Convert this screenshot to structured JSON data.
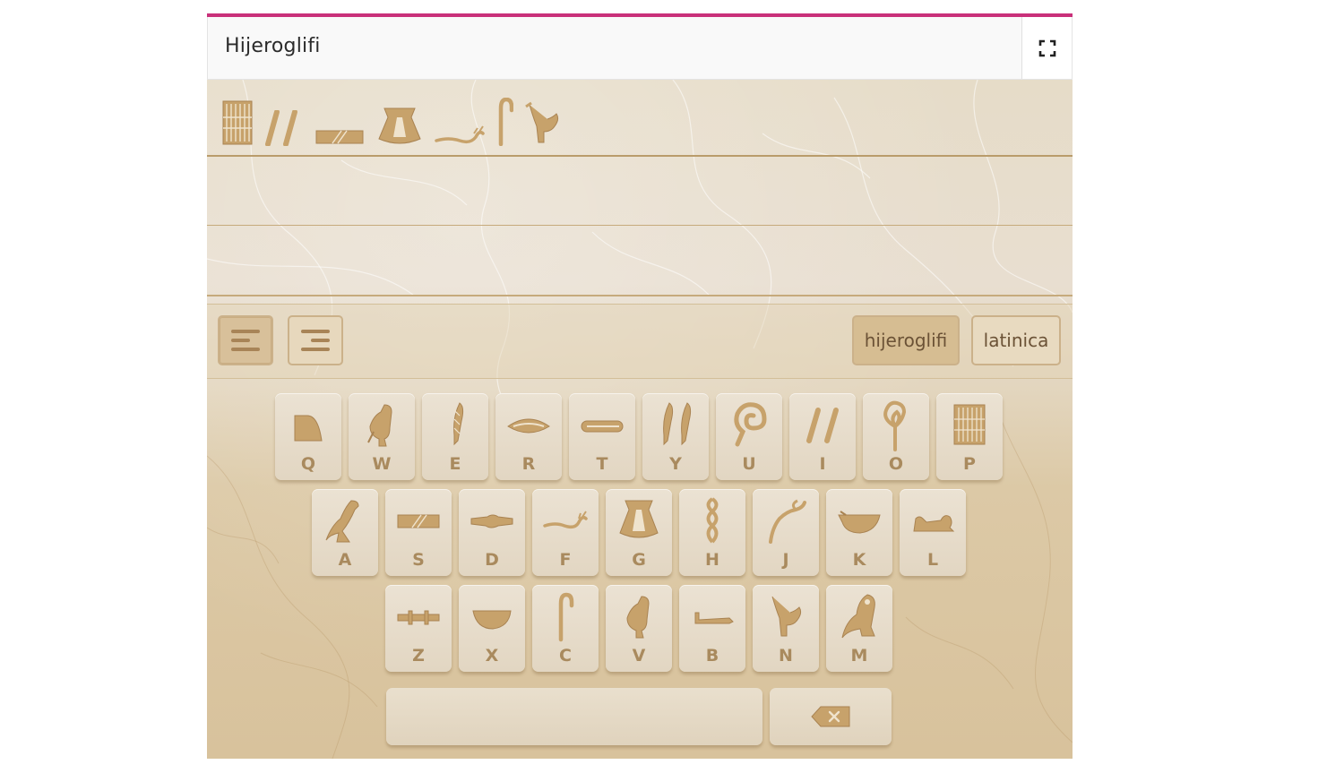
{
  "widget": {
    "title": "Hijeroglifi",
    "accent_color": "#c9307a"
  },
  "toolbar": {
    "align_left_icon": "align-left-icon",
    "align_right_icon": "align-right-icon",
    "mode_hieroglyphs": "hijeroglifi",
    "mode_latin": "latinica"
  },
  "display": {
    "typed_glyphs": [
      "P",
      "I",
      "S",
      "G",
      "F",
      "C",
      "N"
    ]
  },
  "keyboard": {
    "row1": [
      "Q",
      "W",
      "E",
      "R",
      "T",
      "Y",
      "U",
      "I",
      "O",
      "P"
    ],
    "row2": [
      "A",
      "S",
      "D",
      "F",
      "G",
      "H",
      "J",
      "K",
      "L"
    ],
    "row3": [
      "Z",
      "X",
      "C",
      "V",
      "B",
      "N",
      "M"
    ],
    "space_label": "",
    "backspace_icon": "backspace-icon"
  },
  "colors": {
    "glyph": "#c7a26b",
    "glyph_dark": "#8f6a3a",
    "letter": "#a98a5e"
  }
}
